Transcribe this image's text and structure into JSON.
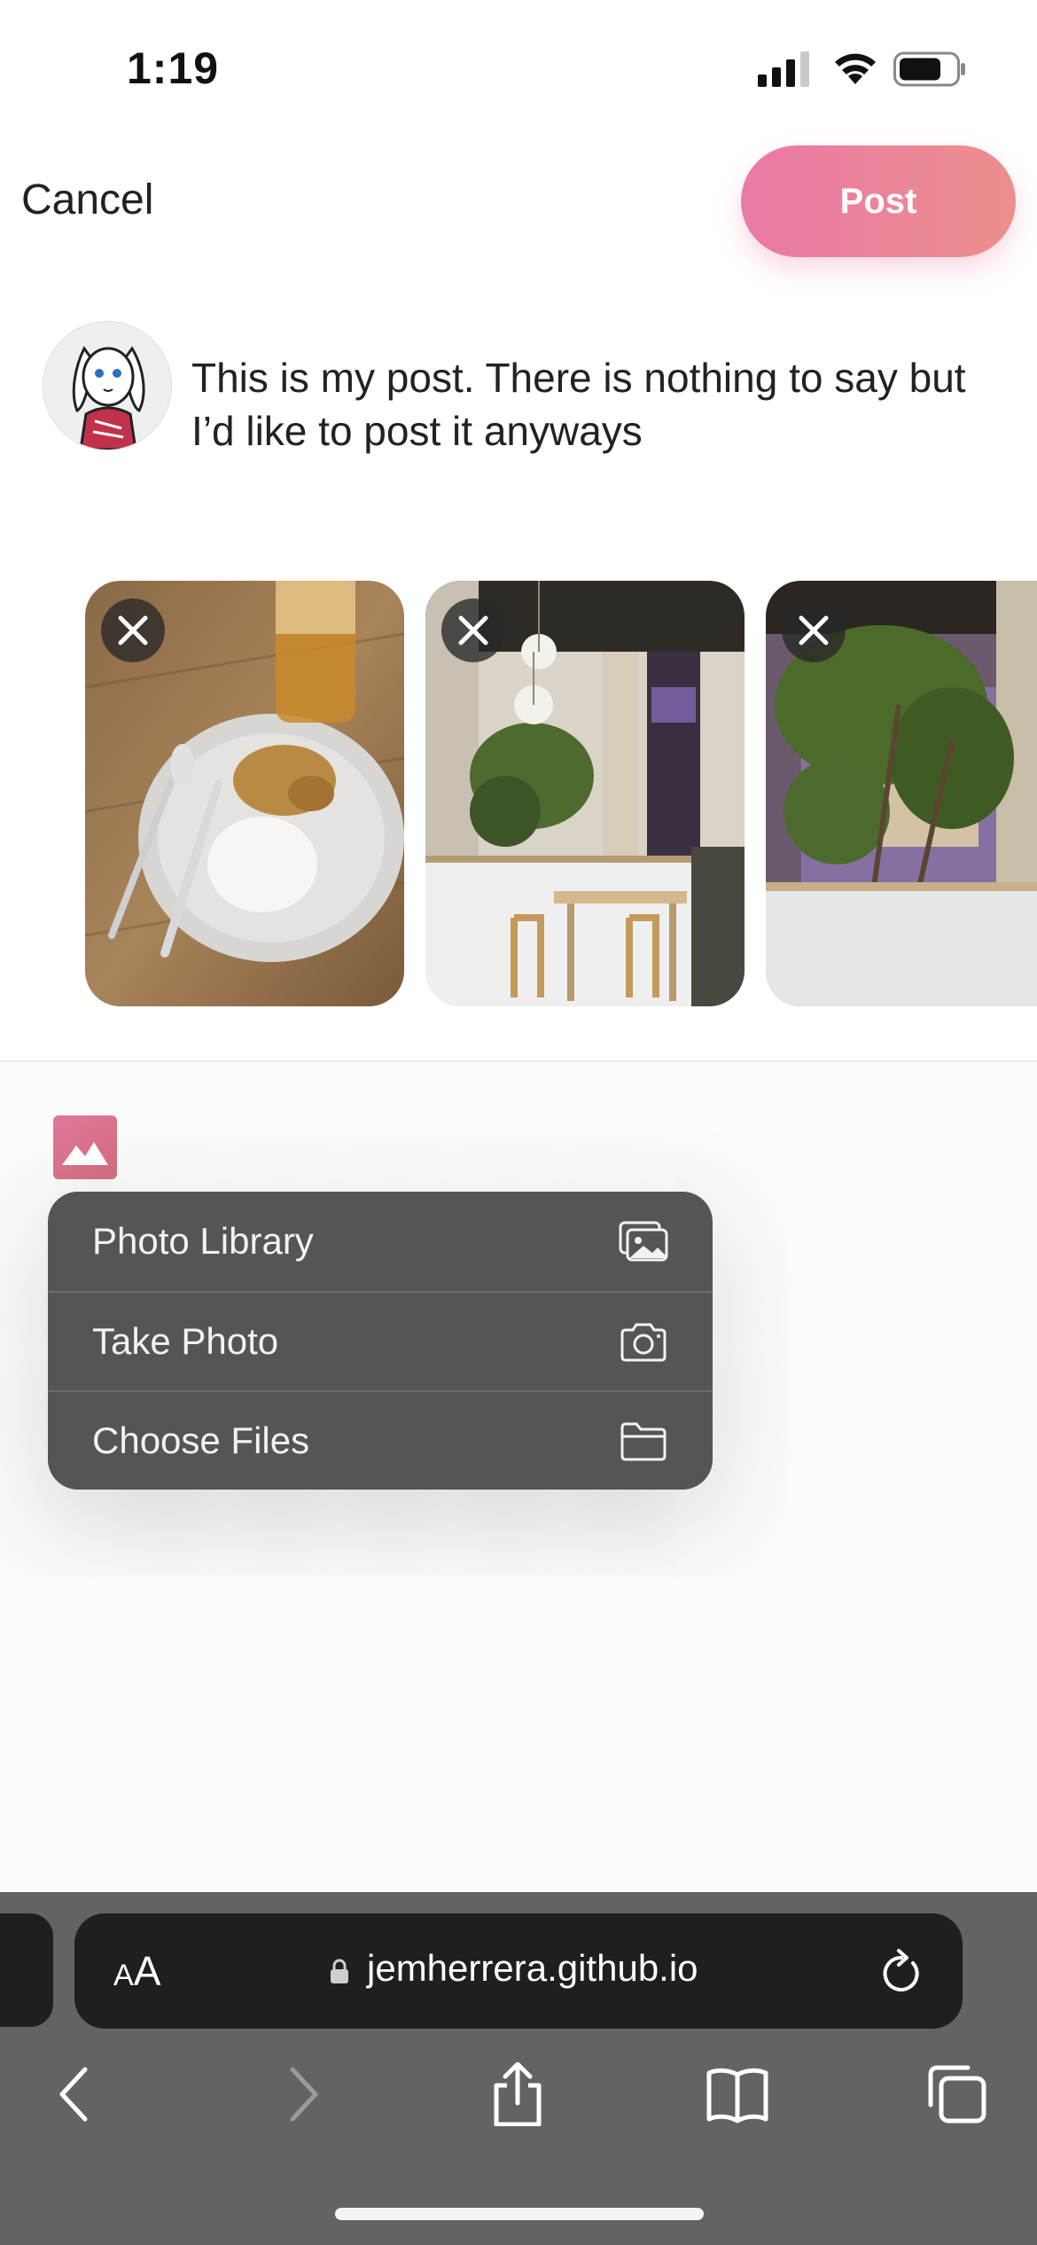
{
  "status_bar": {
    "time": "1:19"
  },
  "header": {
    "cancel_label": "Cancel",
    "post_label": "Post"
  },
  "composer": {
    "avatar_icon": "bunny-avatar-icon",
    "text": "This is my post. There is nothing to say but I’d like to post it anyways"
  },
  "attachments": [
    {
      "description": "plate of rice and chicken with a glass of tea",
      "remove_icon": "close-icon"
    },
    {
      "description": "cafe interior with table, chairs and hanging plants",
      "remove_icon": "close-icon"
    },
    {
      "description": "indoor tree in front of cafe window",
      "remove_icon": "close-icon"
    }
  ],
  "toolbar": {
    "add_image_icon": "image-icon"
  },
  "image_source_menu": {
    "items": [
      {
        "label": "Photo Library",
        "icon": "photo-library-icon"
      },
      {
        "label": "Take Photo",
        "icon": "camera-icon"
      },
      {
        "label": "Choose Files",
        "icon": "folder-icon"
      }
    ]
  },
  "browser": {
    "text_size_label_small": "A",
    "text_size_label_large": "A",
    "url": "jemherrera.github.io"
  }
}
